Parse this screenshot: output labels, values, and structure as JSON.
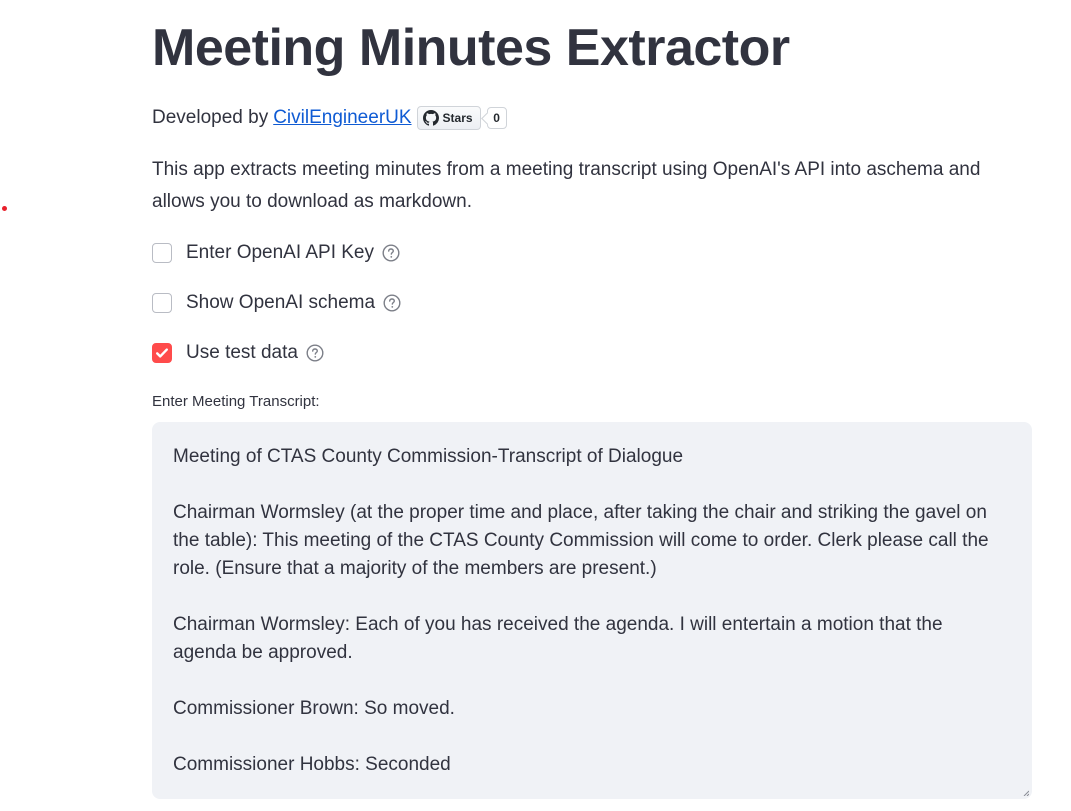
{
  "app": {
    "title": "Meeting Minutes Extractor",
    "developed_by_prefix": "Developed by",
    "developer_link": "CivilEngineerUK",
    "github_button_label": "Stars",
    "github_star_count": "0",
    "description": "This app extracts meeting minutes from a meeting transcript using OpenAI's API into aschema and allows you to download as markdown."
  },
  "options": [
    {
      "label": "Enter OpenAI API Key",
      "checked": false
    },
    {
      "label": "Show OpenAI schema",
      "checked": false
    },
    {
      "label": "Use test data",
      "checked": true
    }
  ],
  "transcript": {
    "label": "Enter Meeting Transcript:",
    "paragraphs": [
      "Meeting of CTAS County Commission-Transcript of Dialogue",
      "Chairman Wormsley (at the proper time and place, after taking the chair and striking the gavel on the table): This meeting of the CTAS County Commission will come to order. Clerk please call the role. (Ensure that a majority of the members are present.)",
      "Chairman Wormsley: Each of you has received the agenda. I will entertain a motion that the agenda be approved.",
      "Commissioner Brown: So moved.",
      "Commissioner Hobbs: Seconded"
    ]
  },
  "colors": {
    "accent": "#ff4b4b",
    "link": "#0f5bd4",
    "text": "#31333f",
    "input_bg": "#f0f2f6"
  },
  "icons": {
    "github": "github-mark-icon",
    "help": "question-circle-icon",
    "check": "check-icon",
    "resize": "resize-grip-icon"
  }
}
